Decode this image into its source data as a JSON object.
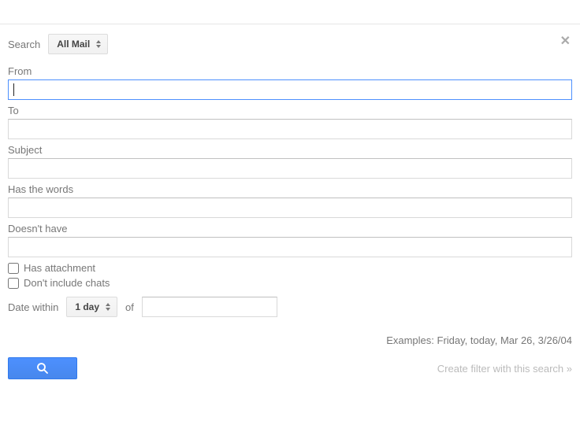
{
  "header": {
    "search_label": "Search",
    "search_scope": "All Mail"
  },
  "fields": {
    "from_label": "From",
    "from_value": "",
    "to_label": "To",
    "to_value": "",
    "subject_label": "Subject",
    "subject_value": "",
    "has_words_label": "Has the words",
    "has_words_value": "",
    "doesnt_have_label": "Doesn't have",
    "doesnt_have_value": ""
  },
  "checkboxes": {
    "has_attachment_label": "Has attachment",
    "has_attachment_checked": false,
    "dont_include_chats_label": "Don't include chats",
    "dont_include_chats_checked": false
  },
  "date": {
    "within_label": "Date within",
    "within_value": "1 day",
    "of_label": "of",
    "date_value": ""
  },
  "footer": {
    "examples_text": "Examples: Friday, today, Mar 26, 3/26/04",
    "filter_link_text": "Create filter with this search »"
  }
}
